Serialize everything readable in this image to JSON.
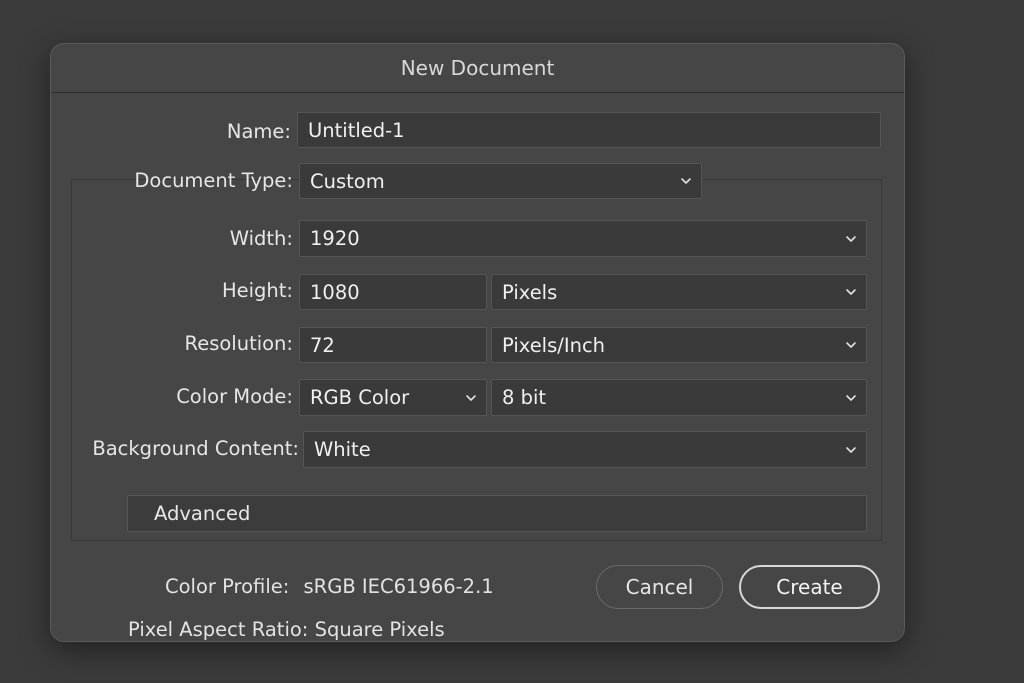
{
  "dialog": {
    "title": "New Document"
  },
  "form": {
    "name_label": "Name:",
    "name_value": "Untitled-1",
    "document_type_label": "Document Type:",
    "document_type_value": "Custom",
    "width_label": "Width:",
    "width_value": "1920",
    "height_label": "Height:",
    "height_value": "1080",
    "height_unit": "Pixels",
    "resolution_label": "Resolution:",
    "resolution_value": "72",
    "resolution_unit": "Pixels/Inch",
    "color_mode_label": "Color Mode:",
    "color_mode_value": "RGB Color",
    "bit_depth_value": "8 bit",
    "background_label": "Background Content:",
    "background_value": "White",
    "advanced_label": "Advanced"
  },
  "info": {
    "color_profile_label": "Color Profile:",
    "color_profile_value": "sRGB IEC61966-2.1",
    "pixel_aspect_label": "Pixel Aspect Ratio:",
    "pixel_aspect_value": "Square Pixels"
  },
  "buttons": {
    "cancel": "Cancel",
    "create": "Create"
  },
  "icons": {
    "dropdown": "chevron-down-icon"
  },
  "colors": {
    "dialog_bg": "#464646",
    "field_bg": "#3a3a3a",
    "page_bg": "#3b3b3b"
  }
}
